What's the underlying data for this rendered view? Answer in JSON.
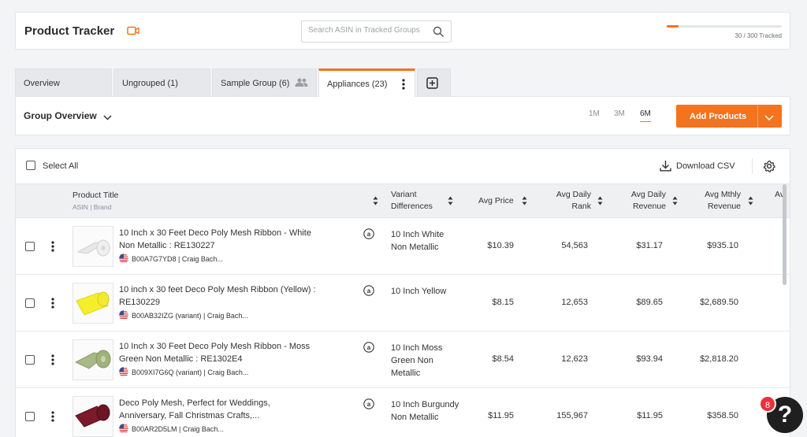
{
  "header": {
    "title": "Product Tracker",
    "search_placeholder": "Search ASIN in Tracked Groups",
    "tracked_count": "30 / 300 Tracked",
    "tracked_fraction": 0.1,
    "accent": "#f4731f"
  },
  "tabs": [
    {
      "label": "Overview"
    },
    {
      "label": "Ungrouped (1)"
    },
    {
      "label": "Sample Group (6)"
    },
    {
      "label": "Appliances (23)"
    }
  ],
  "group": {
    "title": "Group Overview",
    "ranges": [
      "1M",
      "3M",
      "6M"
    ],
    "active_range": "6M",
    "add_button": "Add Products"
  },
  "toolbar": {
    "select_all": "Select All",
    "download": "Download CSV"
  },
  "columns": {
    "title": "Product Title",
    "title_sub": "ASIN | Brand",
    "variant": [
      "Variant",
      "Differences"
    ],
    "avg_price": "Avg Price",
    "avg_rank": [
      "Avg Daily",
      "Rank"
    ],
    "avg_revenue": [
      "Avg Daily",
      "Revenue"
    ],
    "avg_monthly": [
      "Avg Mthly",
      "Revenue"
    ],
    "next_partial": "Av"
  },
  "rows": [
    {
      "title": "10 Inch x 30 Feet Deco Poly Mesh Ribbon - White Non Metallic : RE130227",
      "meta": "B00A7G7YD8 | Craig Bach...",
      "variant": "10 Inch White Non Metallic",
      "price": "$10.39",
      "rank": "54,563",
      "revenue": "$31.17",
      "monthly": "$935.10",
      "thumb_color": "#f2f2f2"
    },
    {
      "title": "10 inch x 30 feet Deco Poly Mesh Ribbon (Yellow) : RE130229",
      "meta": "B00AB32IZG (variant) | Craig Bach...",
      "variant": "10 Inch Yellow",
      "price": "$8.15",
      "rank": "12,653",
      "revenue": "$89.65",
      "monthly": "$2,689.50",
      "thumb_color": "#f4f03a"
    },
    {
      "title": "10 Inch x 30 Feet Deco Poly Mesh Ribbon - Moss Green Non Metallic : RE1302E4",
      "meta": "B009XI7G6Q (variant) | Craig Bach...",
      "variant": "10 Inch Moss Green Non Metallic",
      "price": "$8.54",
      "rank": "12,623",
      "revenue": "$93.94",
      "monthly": "$2,818.20",
      "thumb_color": "#9fb27a"
    },
    {
      "title": "Deco Poly Mesh, Perfect for Weddings, Anniversary, Fall Christmas Crafts,...",
      "meta": "B00AR2D5LM | Craig Bach...",
      "variant": "10 Inch Burgundy Non Metallic",
      "price": "$11.95",
      "rank": "155,967",
      "revenue": "$11.95",
      "monthly": "$358.50",
      "thumb_color": "#7a1a2a"
    }
  ],
  "help": {
    "icon": "?",
    "badge": "8"
  }
}
